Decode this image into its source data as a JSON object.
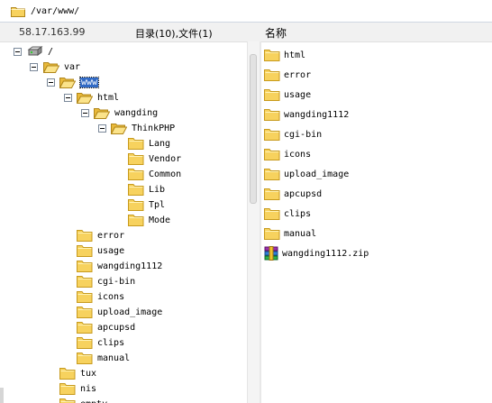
{
  "path": "/var/www/",
  "server_ip": "58.17.163.99",
  "summary": "目录(10),文件(1)",
  "name_column": "名称",
  "tree": {
    "root": "/",
    "var": "var",
    "www": "www",
    "html": "html",
    "wangding": "wangding",
    "thinkphp": "ThinkPHP",
    "thinkphp_children": [
      "Lang",
      "Vendor",
      "Common",
      "Lib",
      "Tpl",
      "Mode"
    ],
    "www_children": [
      "error",
      "usage",
      "wangding1112",
      "cgi-bin",
      "icons",
      "upload_image",
      "apcupsd",
      "clips",
      "manual"
    ],
    "var_siblings": [
      "tux",
      "nis",
      "empty"
    ]
  },
  "list": {
    "folders": [
      "html",
      "error",
      "usage",
      "wangding1112",
      "cgi-bin",
      "icons",
      "upload_image",
      "apcupsd",
      "clips",
      "manual"
    ],
    "file": "wangding1112.zip"
  },
  "colors": {
    "selection": "#316ac5",
    "folder_fill": "#f7d25e",
    "folder_stroke": "#c79a1c"
  }
}
